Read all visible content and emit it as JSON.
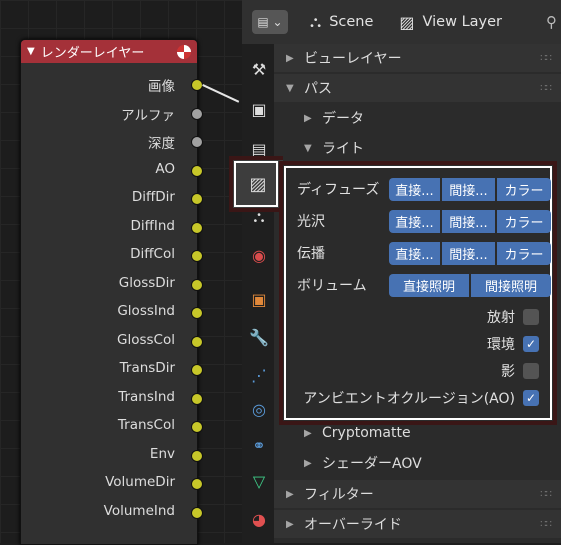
{
  "node": {
    "title": "レンダーレイヤー",
    "sockets": [
      "画像",
      "アルファ",
      "深度",
      "AO",
      "DiffDir",
      "DiffInd",
      "DiffCol",
      "GlossDir",
      "GlossInd",
      "GlossCol",
      "TransDir",
      "TransInd",
      "TransCol",
      "Env",
      "VolumeDir",
      "VolumeInd"
    ]
  },
  "header": {
    "scene": "Scene",
    "view_layer": "View Layer"
  },
  "panels": {
    "view_layer": "ビューレイヤー",
    "passes": "パス",
    "data": "データ",
    "light": "ライト",
    "cryptomatte": "Cryptomatte",
    "shader_aov": "シェーダーAOV",
    "filter": "フィルター",
    "override": "オーバーライド"
  },
  "light": {
    "rows": [
      {
        "label": "ディフューズ",
        "buttons": [
          "直接...",
          "間接...",
          "カラー"
        ]
      },
      {
        "label": "光沢",
        "buttons": [
          "直接...",
          "間接...",
          "カラー"
        ]
      },
      {
        "label": "伝播",
        "buttons": [
          "直接...",
          "間接...",
          "カラー"
        ]
      }
    ],
    "volume": {
      "label": "ボリューム",
      "buttons": [
        "直接照明",
        "間接照明"
      ]
    },
    "checks": [
      {
        "label": "放射",
        "checked": false
      },
      {
        "label": "環境",
        "checked": true
      },
      {
        "label": "影",
        "checked": false
      },
      {
        "label": "アンビエントオクルージョン(AO)",
        "checked": true
      }
    ]
  }
}
